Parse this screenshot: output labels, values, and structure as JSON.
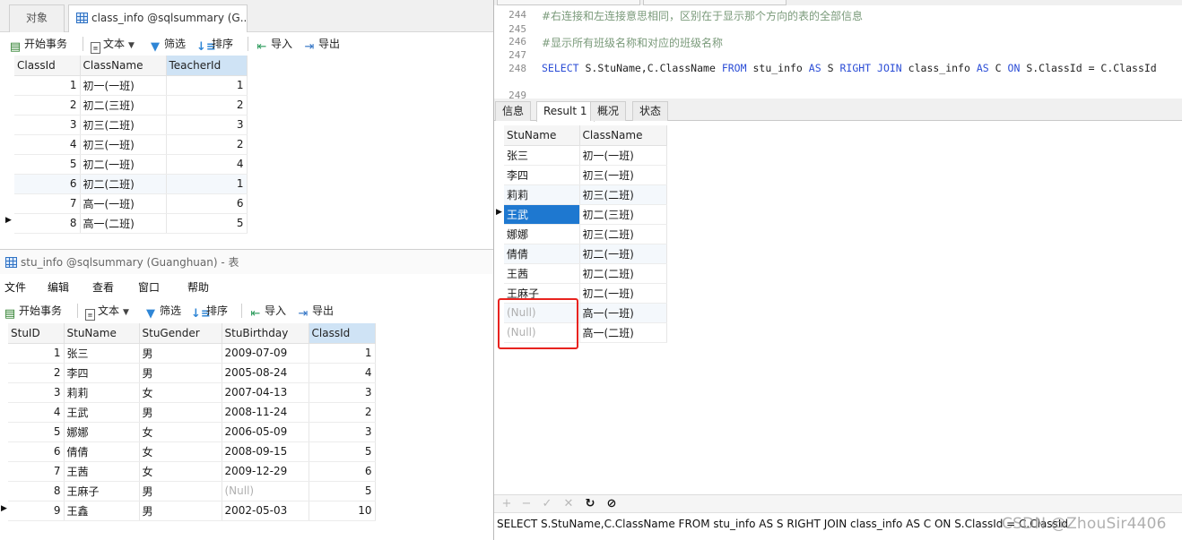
{
  "top": {
    "tabs": {
      "objects": "对象",
      "class_info": "class_info @sqlsummary (G..."
    },
    "toolbar": {
      "begin": "开始事务",
      "text": "文本",
      "filter": "筛选",
      "sort": "排序",
      "import": "导入",
      "export": "导出"
    },
    "grid": {
      "columns": [
        "ClassId",
        "ClassName",
        "TeacherId"
      ],
      "rows": [
        [
          "1",
          "初一(一班)",
          "1"
        ],
        [
          "2",
          "初二(三班)",
          "2"
        ],
        [
          "3",
          "初三(二班)",
          "3"
        ],
        [
          "4",
          "初三(一班)",
          "2"
        ],
        [
          "5",
          "初二(一班)",
          "4"
        ],
        [
          "6",
          "初二(二班)",
          "1"
        ],
        [
          "7",
          "高一(一班)",
          "6"
        ],
        [
          "8",
          "高一(二班)",
          "5"
        ]
      ]
    }
  },
  "bottom": {
    "title": "stu_info @sqlsummary (Guanghuan) - 表",
    "menu": [
      "文件",
      "编辑",
      "查看",
      "窗口",
      "帮助"
    ],
    "toolbar": {
      "begin": "开始事务",
      "text": "文本",
      "filter": "筛选",
      "sort": "排序",
      "import": "导入",
      "export": "导出"
    },
    "grid": {
      "columns": [
        "StuID",
        "StuName",
        "StuGender",
        "StuBirthday",
        "ClassId"
      ],
      "rows": [
        [
          "1",
          "张三",
          "男",
          "2009-07-09",
          "1"
        ],
        [
          "2",
          "李四",
          "男",
          "2005-08-24",
          "4"
        ],
        [
          "3",
          "莉莉",
          "女",
          "2007-04-13",
          "3"
        ],
        [
          "4",
          "王武",
          "男",
          "2008-11-24",
          "2"
        ],
        [
          "5",
          "娜娜",
          "女",
          "2006-05-09",
          "3"
        ],
        [
          "6",
          "倩倩",
          "女",
          "2008-09-15",
          "5"
        ],
        [
          "7",
          "王茜",
          "女",
          "2009-12-29",
          "6"
        ],
        [
          "8",
          "王麻子",
          "男",
          "(Null)",
          "5"
        ],
        [
          "9",
          "王鑫",
          "男",
          "2002-05-03",
          "10"
        ]
      ]
    }
  },
  "editor": {
    "lines": [
      {
        "num": "244",
        "text": "#右连接和左连接意思相同，区别在于显示那个方向的表的全部信息"
      },
      {
        "num": "245",
        "text": ""
      },
      {
        "num": "246",
        "text": "#显示所有班级名称和对应的班级名称"
      },
      {
        "num": "247",
        "text": ""
      },
      {
        "num": "248",
        "text": ""
      },
      {
        "num": "249",
        "text": ""
      }
    ],
    "sql": {
      "select": "SELECT",
      "cols": "S.StuName,C.ClassName",
      "from": "FROM",
      "t1": "stu_info",
      "as1": "AS",
      "a1": "S",
      "right": "RIGHT",
      "join": "JOIN",
      "t2": "class_info",
      "as2": "AS",
      "a2": "C",
      "on": "ON",
      "cond": "S.ClassId = C.ClassId"
    }
  },
  "result": {
    "tabs": [
      "信息",
      "Result 1",
      "概况",
      "状态"
    ],
    "columns": [
      "StuName",
      "ClassName"
    ],
    "rows": [
      [
        "张三",
        "初一(一班)"
      ],
      [
        "李四",
        "初三(一班)"
      ],
      [
        "莉莉",
        "初三(二班)"
      ],
      [
        "王武",
        "初二(三班)"
      ],
      [
        "娜娜",
        "初三(二班)"
      ],
      [
        "倩倩",
        "初二(一班)"
      ],
      [
        "王茜",
        "初二(二班)"
      ],
      [
        "王麻子",
        "初二(一班)"
      ],
      [
        "(Null)",
        "高一(一班)"
      ],
      [
        "(Null)",
        "高一(二班)"
      ]
    ],
    "nav": [
      "+",
      "−",
      "✓",
      "✕",
      "↻",
      "⊘"
    ],
    "status": "SELECT S.StuName,C.ClassName FROM stu_info AS S RIGHT JOIN class_info AS C ON S.ClassId = C.ClassId"
  },
  "watermark": "CSDN @ZhouSir4406",
  "colors": {
    "accent": "#1e78d0",
    "highlight": "#e8231f",
    "keyword": "#2b4dd6",
    "comment": "#7a9a7a"
  }
}
